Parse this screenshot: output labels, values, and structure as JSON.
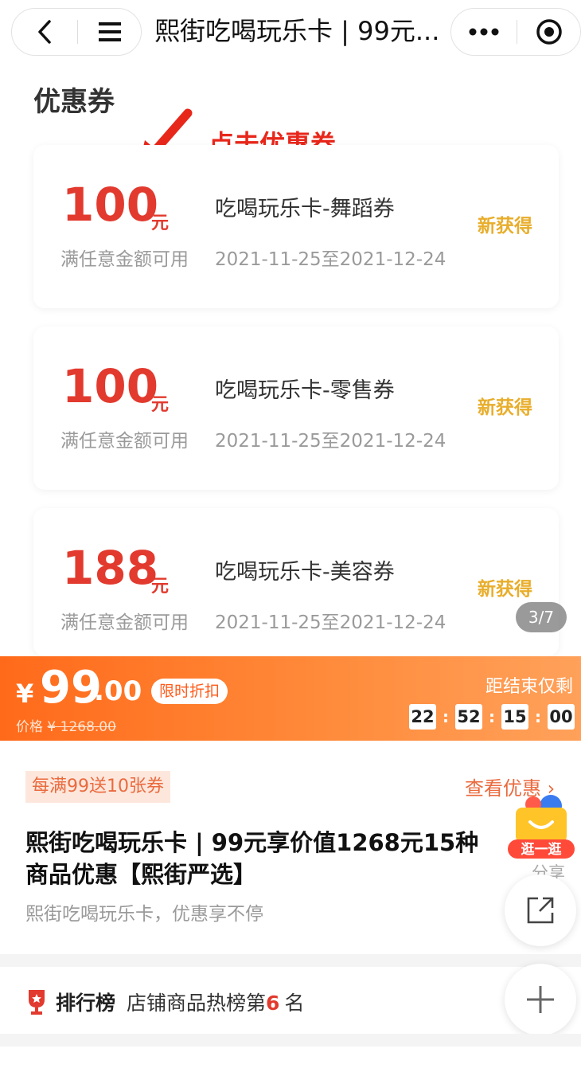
{
  "nav": {
    "title": "熙街吃喝玩乐卡 | 99元..."
  },
  "coupons_section": {
    "title": "优惠券",
    "hint": "点击优惠券",
    "items": [
      {
        "amount": "100",
        "unit": "元",
        "condition": "满任意金额可用",
        "name": "吃喝玩乐卡-舞蹈券",
        "date": "2021-11-25至2021-12-24",
        "status": "新获得"
      },
      {
        "amount": "100",
        "unit": "元",
        "condition": "满任意金额可用",
        "name": "吃喝玩乐卡-零售券",
        "date": "2021-11-25至2021-12-24",
        "status": "新获得"
      },
      {
        "amount": "188",
        "unit": "元",
        "condition": "满任意金额可用",
        "name": "吃喝玩乐卡-美容券",
        "date": "2021-11-25至2021-12-24",
        "status": "新获得"
      }
    ],
    "page_indicator": "3/7"
  },
  "price": {
    "currency": "¥",
    "integer": "99",
    "decimal": ".00",
    "tag": "限时折扣",
    "original_label": "价格",
    "original_price": "¥ 1268.00",
    "countdown_label": "距结束仅剩",
    "countdown": [
      "22",
      "52",
      "15",
      "00"
    ]
  },
  "product": {
    "promo_tag": "每满99送10张券",
    "view_promo": "查看优惠",
    "title": "熙街吃喝玩乐卡 | 99元享价值1268元15种商品优惠【熙街严选】",
    "subtitle": "熙街吃喝玩乐卡，优惠享不停",
    "float_badge_label": "逛一逛",
    "share_label": "分享"
  },
  "ranking": {
    "label": "排行榜",
    "text_prefix": "店铺商品热榜第",
    "rank": "6",
    "text_suffix": "名"
  },
  "colors": {
    "accent_red": "#e23a2e",
    "orange": "#ff6a1a",
    "status_yellow": "#e8ad2a"
  }
}
